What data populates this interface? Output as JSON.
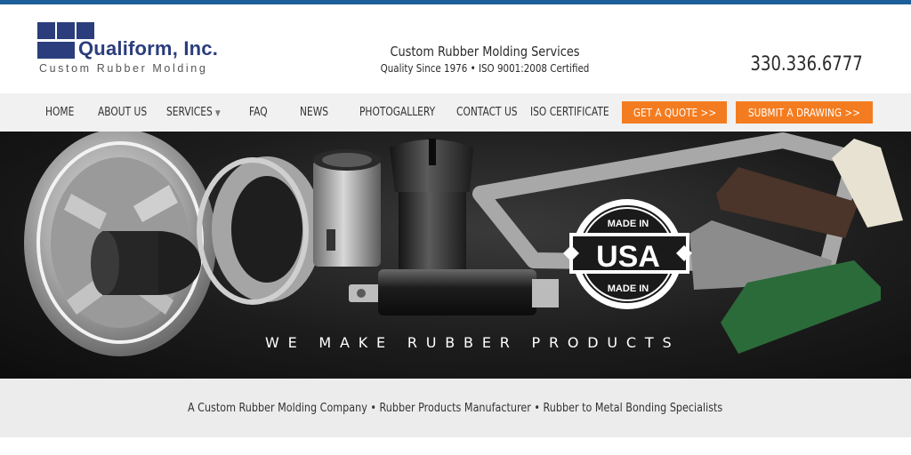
{
  "brand": {
    "name": "Qualiform, Inc.",
    "tagline": "Custom Rubber Molding",
    "accent_color": "#2b3d7c",
    "top_bar_color": "#1d5f99"
  },
  "header": {
    "title": "Custom Rubber Molding Services",
    "subtitle": "Quality Since 1976 • ISO 9001:2008 Certified",
    "phone": "330.336.6777"
  },
  "nav": {
    "items": [
      {
        "label": "HOME"
      },
      {
        "label": "ABOUT US"
      },
      {
        "label": "SERVICES"
      },
      {
        "label": "FAQ"
      },
      {
        "label": "NEWS"
      },
      {
        "label": "PHOTOGALLERY"
      },
      {
        "label": "CONTACT US"
      },
      {
        "label": "ISO CERTIFICATE"
      }
    ],
    "services_dropdown_icon": "chevron-down-icon",
    "quote_button": "GET A QUOTE >>",
    "drawing_button": "SUBMIT A DRAWING >>",
    "button_color": "#f47c20"
  },
  "hero": {
    "caption": "WE MAKE RUBBER PRODUCTS",
    "badge_top": "MADE IN",
    "badge_main": "USA",
    "badge_bottom": "MADE IN"
  },
  "footer_strip": {
    "text": "A Custom Rubber Molding Company • Rubber Products Manufacturer • Rubber to Metal Bonding Specialists"
  }
}
